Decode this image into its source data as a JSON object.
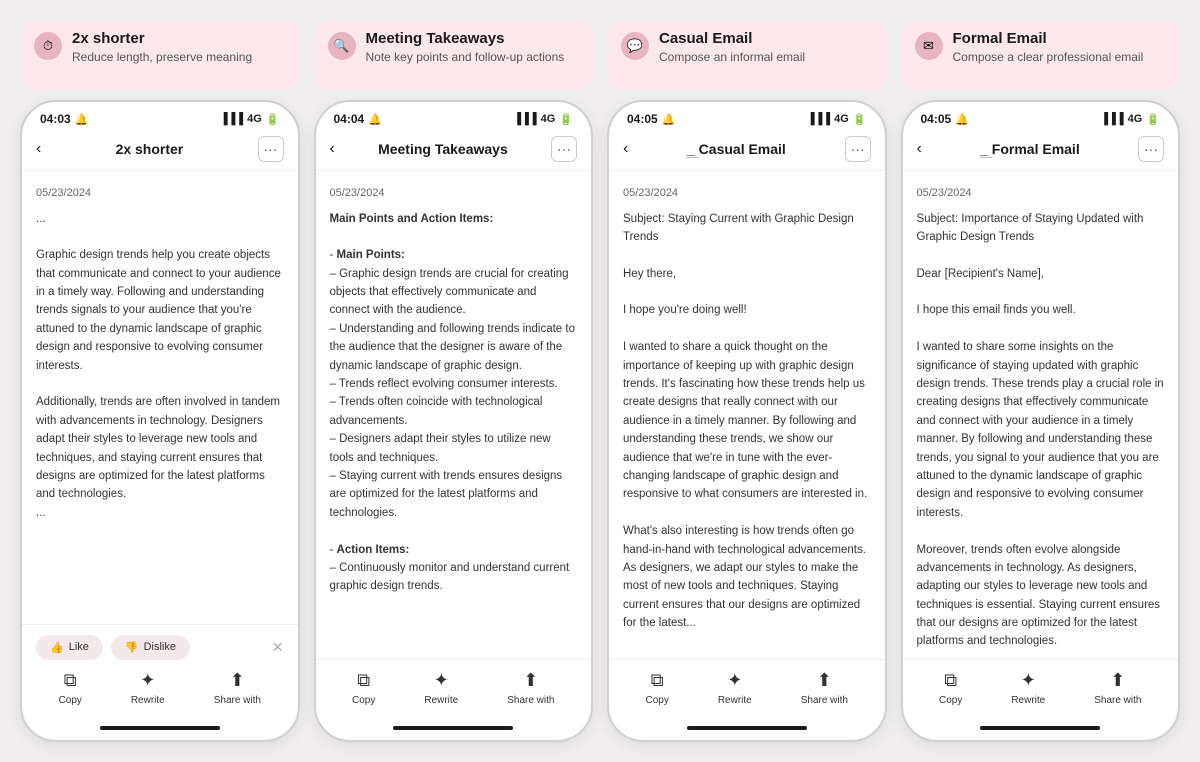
{
  "columns": [
    {
      "id": "shorter",
      "badge": {
        "icon": "⏱",
        "title": "2x shorter",
        "subtitle": "Reduce length, preserve meaning"
      },
      "phone": {
        "time": "04:03",
        "signal": "📶 4G 🔋",
        "nav_title": "2x shorter",
        "date": "05/23/2024",
        "body": "...\n\nGraphic design trends help you create objects that communicate and connect to your audience in a timely way. Following and understanding trends signals to your audience that you're attuned to the dynamic landscape of graphic design and responsive to evolving consumer interests.\n\nAdditionally, trends are often involved in tandem with advancements in technology. Designers adapt their styles to leverage new tools and techniques, and staying current ensures that designs are optimized for the latest platforms and technologies.\n...",
        "show_feedback": true
      }
    },
    {
      "id": "meeting",
      "badge": {
        "icon": "🔍",
        "title": "Meeting Takeaways",
        "subtitle": "Note key points and follow-up actions"
      },
      "phone": {
        "time": "04:04",
        "signal": "📶 4G 🔋",
        "nav_title": "Meeting Takeaways",
        "date": "05/23/2024",
        "body": "**Main Points and Action Items:**\n\n- **Main Points:**\n  – Graphic design trends are crucial for creating objects that effectively communicate and connect with the audience.\n  – Understanding and following trends indicate to the audience that the designer is aware of the dynamic landscape of graphic design.\n  – Trends reflect evolving consumer interests.\n  – Trends often coincide with technological advancements.\n  – Designers adapt their styles to utilize new tools and techniques.\n  – Staying current with trends ensures designs are optimized for the latest platforms and technologies.\n\n- **Action Items:**\n  – Continuously monitor and understand current graphic design trends.",
        "show_feedback": false
      }
    },
    {
      "id": "casual",
      "badge": {
        "icon": "💬",
        "title": "Casual Email",
        "subtitle": "Compose an informal email"
      },
      "phone": {
        "time": "04:05",
        "signal": "📶 4G 🔋",
        "nav_title": "Casual Email",
        "date": "05/23/2024",
        "body": "Subject: Staying Current with Graphic Design Trends\n\nHey there,\n\nI hope you're doing well!\n\nI wanted to share a quick thought on the importance of keeping up with graphic design trends. It's fascinating how these trends help us create designs that really connect with our audience in a timely manner. By following and understanding these trends, we show our audience that we're in tune with the ever-changing landscape of graphic design and responsive to what consumers are interested in.\n\nWhat's also interesting is how trends often go hand-in-hand with technological advancements. As designers, we adapt our styles to make the most of new tools and techniques. Staying current ensures that our designs are optimized for the latest...",
        "show_feedback": false
      }
    },
    {
      "id": "formal",
      "badge": {
        "icon": "✉",
        "title": "Formal Email",
        "subtitle": "Compose a clear professional email"
      },
      "phone": {
        "time": "04:05",
        "signal": "📶 4G 🔋",
        "nav_title": "Formal Email",
        "date": "05/23/2024",
        "body": "Subject: Importance of Staying Updated with Graphic Design Trends\n\nDear [Recipient's Name],\n\nI hope this email finds you well.\n\nI wanted to share some insights on the significance of staying updated with graphic design trends. These trends play a crucial role in creating designs that effectively communicate and connect with your audience in a timely manner. By following and understanding these trends, you signal to your audience that you are attuned to the dynamic landscape of graphic design and responsive to evolving consumer interests.\n\nMoreover, trends often evolve alongside advancements in technology. As designers, adapting our styles to leverage new tools and techniques is essential. Staying current ensures that our designs are optimized for the latest platforms and technologies.",
        "show_feedback": false
      }
    }
  ],
  "actions": {
    "copy": "Copy",
    "rewrite": "Rewrite",
    "share": "Share with"
  },
  "feedback": {
    "like": "Like",
    "dislike": "Dislike"
  }
}
